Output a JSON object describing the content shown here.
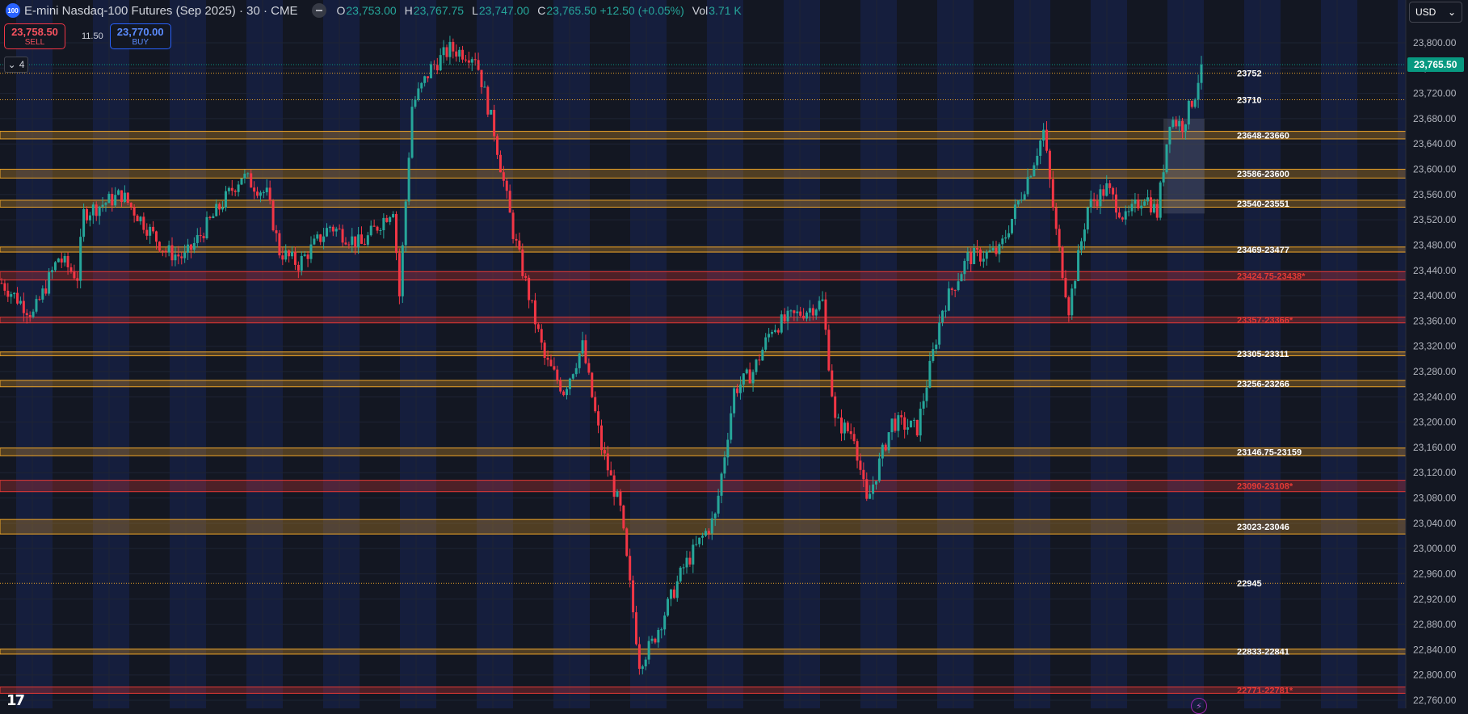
{
  "header": {
    "badge": "100",
    "title": "E-mini Nasdaq-100 Futures (Sep 2025) · 30 · CME",
    "ohlc": [
      {
        "k": "O",
        "v": "23,753.00"
      },
      {
        "k": "H",
        "v": "23,767.75"
      },
      {
        "k": "L",
        "v": "23,747.00"
      },
      {
        "k": "C",
        "v": "23,765.50 +12.50 (+0.05%)"
      },
      {
        "k": "Vol",
        "v": "3.71 K"
      }
    ]
  },
  "trade": {
    "sell_price": "23,758.50",
    "sell_label": "SELL",
    "spread": "11.50",
    "buy_price": "23,770.00",
    "buy_label": "BUY"
  },
  "indicators_count": "4",
  "currency": "USD",
  "logo": "17",
  "bolt_glyph": "⚡",
  "colors": {
    "up": "#26a69a",
    "down": "#f23645",
    "zone": "#f0a628",
    "zone_red": "#e53935",
    "price_tag": "#089981",
    "bg": "#131722",
    "band": "#172554"
  },
  "chart_data": {
    "type": "candlestick",
    "ylim": [
      22760,
      23820
    ],
    "yticks": [
      "23,800.00",
      "23,760.00",
      "23,720.00",
      "23,680.00",
      "23,640.00",
      "23,600.00",
      "23,560.00",
      "23,520.00",
      "23,480.00",
      "23,440.00",
      "23,400.00",
      "23,360.00",
      "23,320.00",
      "23,280.00",
      "23,240.00",
      "23,200.00",
      "23,160.00",
      "23,120.00",
      "23,080.00",
      "23,040.00",
      "23,000.00",
      "22,960.00",
      "22,920.00",
      "22,880.00",
      "22,840.00",
      "22,800.00",
      "22,760.00"
    ],
    "ytick_values": [
      23800,
      23760,
      23720,
      23680,
      23640,
      23600,
      23560,
      23520,
      23480,
      23440,
      23400,
      23360,
      23320,
      23280,
      23240,
      23200,
      23160,
      23120,
      23080,
      23040,
      23000,
      22960,
      22920,
      22880,
      22840,
      22800,
      22760
    ],
    "last_price": 23765.5,
    "last_price_label": "23,765.50",
    "zones": [
      {
        "label": "23648-23660",
        "low": 23648,
        "high": 23660,
        "style": "zone"
      },
      {
        "label": "23586-23600",
        "low": 23586,
        "high": 23600,
        "style": "zone"
      },
      {
        "label": "23540-23551",
        "low": 23540,
        "high": 23551,
        "style": "zone"
      },
      {
        "label": "23469-23477",
        "low": 23469,
        "high": 23477,
        "style": "zone"
      },
      {
        "label": "23424.75-23438*",
        "low": 23424.75,
        "high": 23438,
        "style": "red"
      },
      {
        "label": "23357-23366*",
        "low": 23357,
        "high": 23366,
        "style": "red"
      },
      {
        "label": "23305-23311",
        "low": 23305,
        "high": 23311,
        "style": "zone"
      },
      {
        "label": "23256-23266",
        "low": 23256,
        "high": 23266,
        "style": "zone"
      },
      {
        "label": "23146.75-23159",
        "low": 23146.75,
        "high": 23159,
        "style": "zone"
      },
      {
        "label": "23090-23108*",
        "low": 23090,
        "high": 23108,
        "style": "red"
      },
      {
        "label": "23023-23046",
        "low": 23023,
        "high": 23046,
        "style": "zone"
      },
      {
        "label": "22833-22841",
        "low": 22833,
        "high": 22841,
        "style": "zone"
      },
      {
        "label": "22771-22781*",
        "low": 22771,
        "high": 22781,
        "style": "red"
      }
    ],
    "levels": [
      {
        "label": "23752",
        "value": 23752
      },
      {
        "label": "23710",
        "value": 23710
      },
      {
        "label": "22945",
        "value": 22945
      }
    ],
    "anchors": [
      {
        "i": 0,
        "p": 23420
      },
      {
        "i": 10,
        "p": 23370
      },
      {
        "i": 18,
        "p": 23460
      },
      {
        "i": 24,
        "p": 23430
      },
      {
        "i": 26,
        "p": 23530
      },
      {
        "i": 38,
        "p": 23560
      },
      {
        "i": 52,
        "p": 23470
      },
      {
        "i": 58,
        "p": 23460
      },
      {
        "i": 76,
        "p": 23590
      },
      {
        "i": 84,
        "p": 23560
      },
      {
        "i": 88,
        "p": 23470
      },
      {
        "i": 94,
        "p": 23450
      },
      {
        "i": 104,
        "p": 23510
      },
      {
        "i": 114,
        "p": 23480
      },
      {
        "i": 124,
        "p": 23540
      },
      {
        "i": 126,
        "p": 23400
      },
      {
        "i": 130,
        "p": 23700
      },
      {
        "i": 136,
        "p": 23760
      },
      {
        "i": 142,
        "p": 23790
      },
      {
        "i": 150,
        "p": 23780
      },
      {
        "i": 156,
        "p": 23660
      },
      {
        "i": 162,
        "p": 23500
      },
      {
        "i": 172,
        "p": 23300
      },
      {
        "i": 178,
        "p": 23250
      },
      {
        "i": 184,
        "p": 23320
      },
      {
        "i": 190,
        "p": 23160
      },
      {
        "i": 196,
        "p": 23060
      },
      {
        "i": 202,
        "p": 22820
      },
      {
        "i": 206,
        "p": 22850
      },
      {
        "i": 216,
        "p": 22970
      },
      {
        "i": 226,
        "p": 23050
      },
      {
        "i": 232,
        "p": 23250
      },
      {
        "i": 238,
        "p": 23280
      },
      {
        "i": 244,
        "p": 23350
      },
      {
        "i": 256,
        "p": 23380
      },
      {
        "i": 260,
        "p": 23390
      },
      {
        "i": 264,
        "p": 23200
      },
      {
        "i": 270,
        "p": 23180
      },
      {
        "i": 274,
        "p": 23070
      },
      {
        "i": 282,
        "p": 23200
      },
      {
        "i": 290,
        "p": 23190
      },
      {
        "i": 298,
        "p": 23380
      },
      {
        "i": 306,
        "p": 23460
      },
      {
        "i": 316,
        "p": 23470
      },
      {
        "i": 326,
        "p": 23600
      },
      {
        "i": 330,
        "p": 23660
      },
      {
        "i": 334,
        "p": 23500
      },
      {
        "i": 338,
        "p": 23380
      },
      {
        "i": 344,
        "p": 23540
      },
      {
        "i": 350,
        "p": 23570
      },
      {
        "i": 356,
        "p": 23520
      },
      {
        "i": 362,
        "p": 23560
      },
      {
        "i": 366,
        "p": 23530
      },
      {
        "i": 370,
        "p": 23680
      },
      {
        "i": 374,
        "p": 23670
      },
      {
        "i": 378,
        "p": 23720
      },
      {
        "i": 380,
        "p": 23765.5
      }
    ],
    "candle_count": 381
  }
}
